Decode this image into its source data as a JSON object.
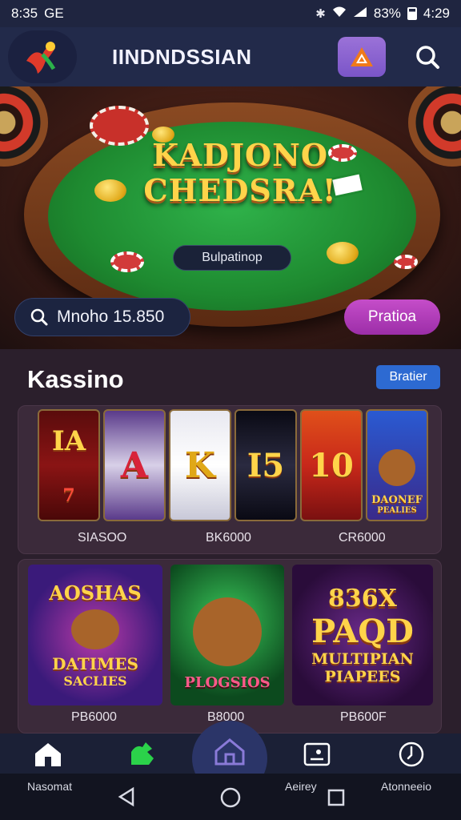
{
  "status": {
    "time_left": "8:35",
    "carrier": "GE",
    "battery": "83%",
    "time_right": "4:29"
  },
  "header": {
    "title": "IINDNDSSIAN"
  },
  "hero": {
    "title_line1": "KADJONO",
    "title_line2": "CHEDSRA!",
    "pill": "Bulpatinop",
    "search_text": "Mnoho 15.850",
    "play_label": "Pratioa"
  },
  "section": {
    "title": "Kassino",
    "badge": "Bratier"
  },
  "slots": [
    {
      "symbols": [
        "IA",
        "7"
      ],
      "label": "SIASOO"
    },
    {
      "symbols": [
        "A"
      ],
      "label": "BK6000"
    },
    {
      "symbols": [
        "K"
      ],
      "label": ""
    },
    {
      "symbols": [
        "I5"
      ],
      "label": "CR6000"
    },
    {
      "symbols": [
        "10"
      ],
      "label": ""
    },
    {
      "symbols": [
        "DAONEF",
        "PEALIES"
      ],
      "label": ""
    }
  ],
  "games": [
    {
      "line1": "AOSHAS",
      "line2": "DATIMES",
      "line3": "SACLIES",
      "label": "PB6000"
    },
    {
      "line1": "PLOGSIOS",
      "label": "B8000"
    },
    {
      "line1": "836X",
      "line2": "PAQD",
      "line3": "MULTIPIAN",
      "line4": "PIAPEES",
      "label": "PB600F"
    }
  ],
  "bottom_nav": {
    "left_label": "Nasomat",
    "mid_label": "Aeirey",
    "right_label": "Atonneeio"
  }
}
